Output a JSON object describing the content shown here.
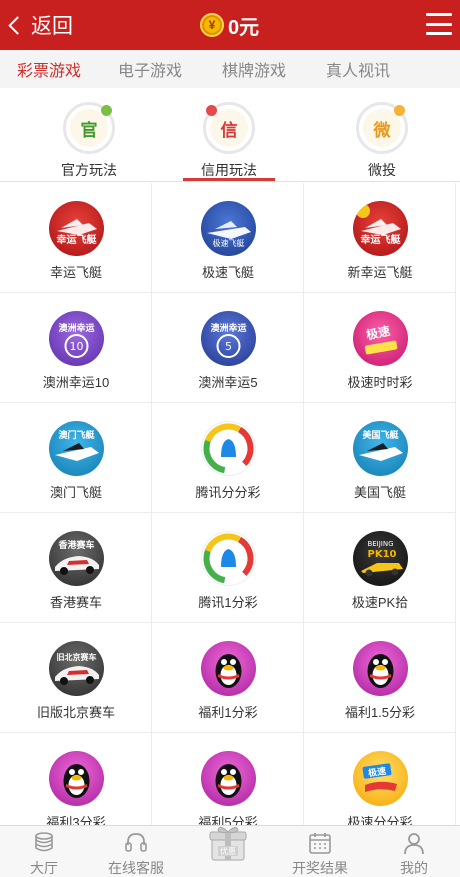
{
  "header": {
    "back_label": "返回",
    "balance": "0元",
    "coin_symbol": "¥"
  },
  "category_tabs": [
    {
      "label": "彩票游戏",
      "active": true
    },
    {
      "label": "电子游戏",
      "active": false
    },
    {
      "label": "棋牌游戏",
      "active": false
    },
    {
      "label": "真人视讯",
      "active": false
    }
  ],
  "mode_tabs": [
    {
      "label": "官方玩法",
      "glyph": "官",
      "glyph_color": "#3f9b2c",
      "dot_color": "#7ac143",
      "active": false
    },
    {
      "label": "信用玩法",
      "glyph": "信",
      "glyph_color": "#d23b3b",
      "dot_color": "#e24b4b",
      "active": true
    },
    {
      "label": "微投",
      "glyph": "微",
      "glyph_color": "#e89a1d",
      "dot_color": "#f5b236",
      "active": false
    }
  ],
  "games": [
    {
      "label": "幸运飞艇",
      "icon": "boat-red-icon",
      "icon_text": "幸运飞艇"
    },
    {
      "label": "极速飞艇",
      "icon": "boat-blue-icon",
      "icon_text": "极速飞艇"
    },
    {
      "label": "新幸运飞艇",
      "icon": "boat-red-new-icon",
      "icon_text": "幸运飞艇"
    },
    {
      "label": "澳洲幸运10",
      "icon": "aus-lucky-10-icon",
      "icon_text": "澳洲幸运",
      "icon_number": "10"
    },
    {
      "label": "澳洲幸运5",
      "icon": "aus-lucky-5-icon",
      "icon_text": "澳洲幸运",
      "icon_number": "5"
    },
    {
      "label": "极速时时彩",
      "icon": "speed-lottery-icon",
      "icon_text": "极速"
    },
    {
      "label": "澳门飞艇",
      "icon": "macau-boat-icon",
      "icon_text": "澳门飞艇"
    },
    {
      "label": "腾讯分分彩",
      "icon": "tencent-icon"
    },
    {
      "label": "美国飞艇",
      "icon": "usa-boat-icon",
      "icon_text": "美国飞艇"
    },
    {
      "label": "香港赛车",
      "icon": "hk-racecar-icon",
      "icon_text": "香港赛车"
    },
    {
      "label": "腾讯1分彩",
      "icon": "tencent-icon"
    },
    {
      "label": "极速PK拾",
      "icon": "beijing-pk10-icon",
      "icon_text": "BEIJING",
      "icon_number": "PK10"
    },
    {
      "label": "旧版北京赛车",
      "icon": "old-beijing-racecar-icon",
      "icon_text": "旧北京赛车"
    },
    {
      "label": "福利1分彩",
      "icon": "qq-penguin-icon"
    },
    {
      "label": "福利1.5分彩",
      "icon": "qq-penguin-icon"
    },
    {
      "label": "福利3分彩",
      "icon": "qq-penguin-icon"
    },
    {
      "label": "福利5分彩",
      "icon": "qq-penguin-icon"
    },
    {
      "label": "极速分分彩",
      "icon": "speed-minute-icon",
      "icon_text": "极速"
    }
  ],
  "bottom_nav": [
    {
      "label": "大厅",
      "icon": "coins-icon"
    },
    {
      "label": "在线客服",
      "icon": "headset-icon"
    },
    {
      "label": "优惠",
      "icon": "gift-icon"
    },
    {
      "label": "开奖结果",
      "icon": "calendar-icon"
    },
    {
      "label": "我的",
      "icon": "user-icon"
    }
  ],
  "colors": {
    "header_red": "#c8201f",
    "active_tab_red": "#d12e2b"
  }
}
